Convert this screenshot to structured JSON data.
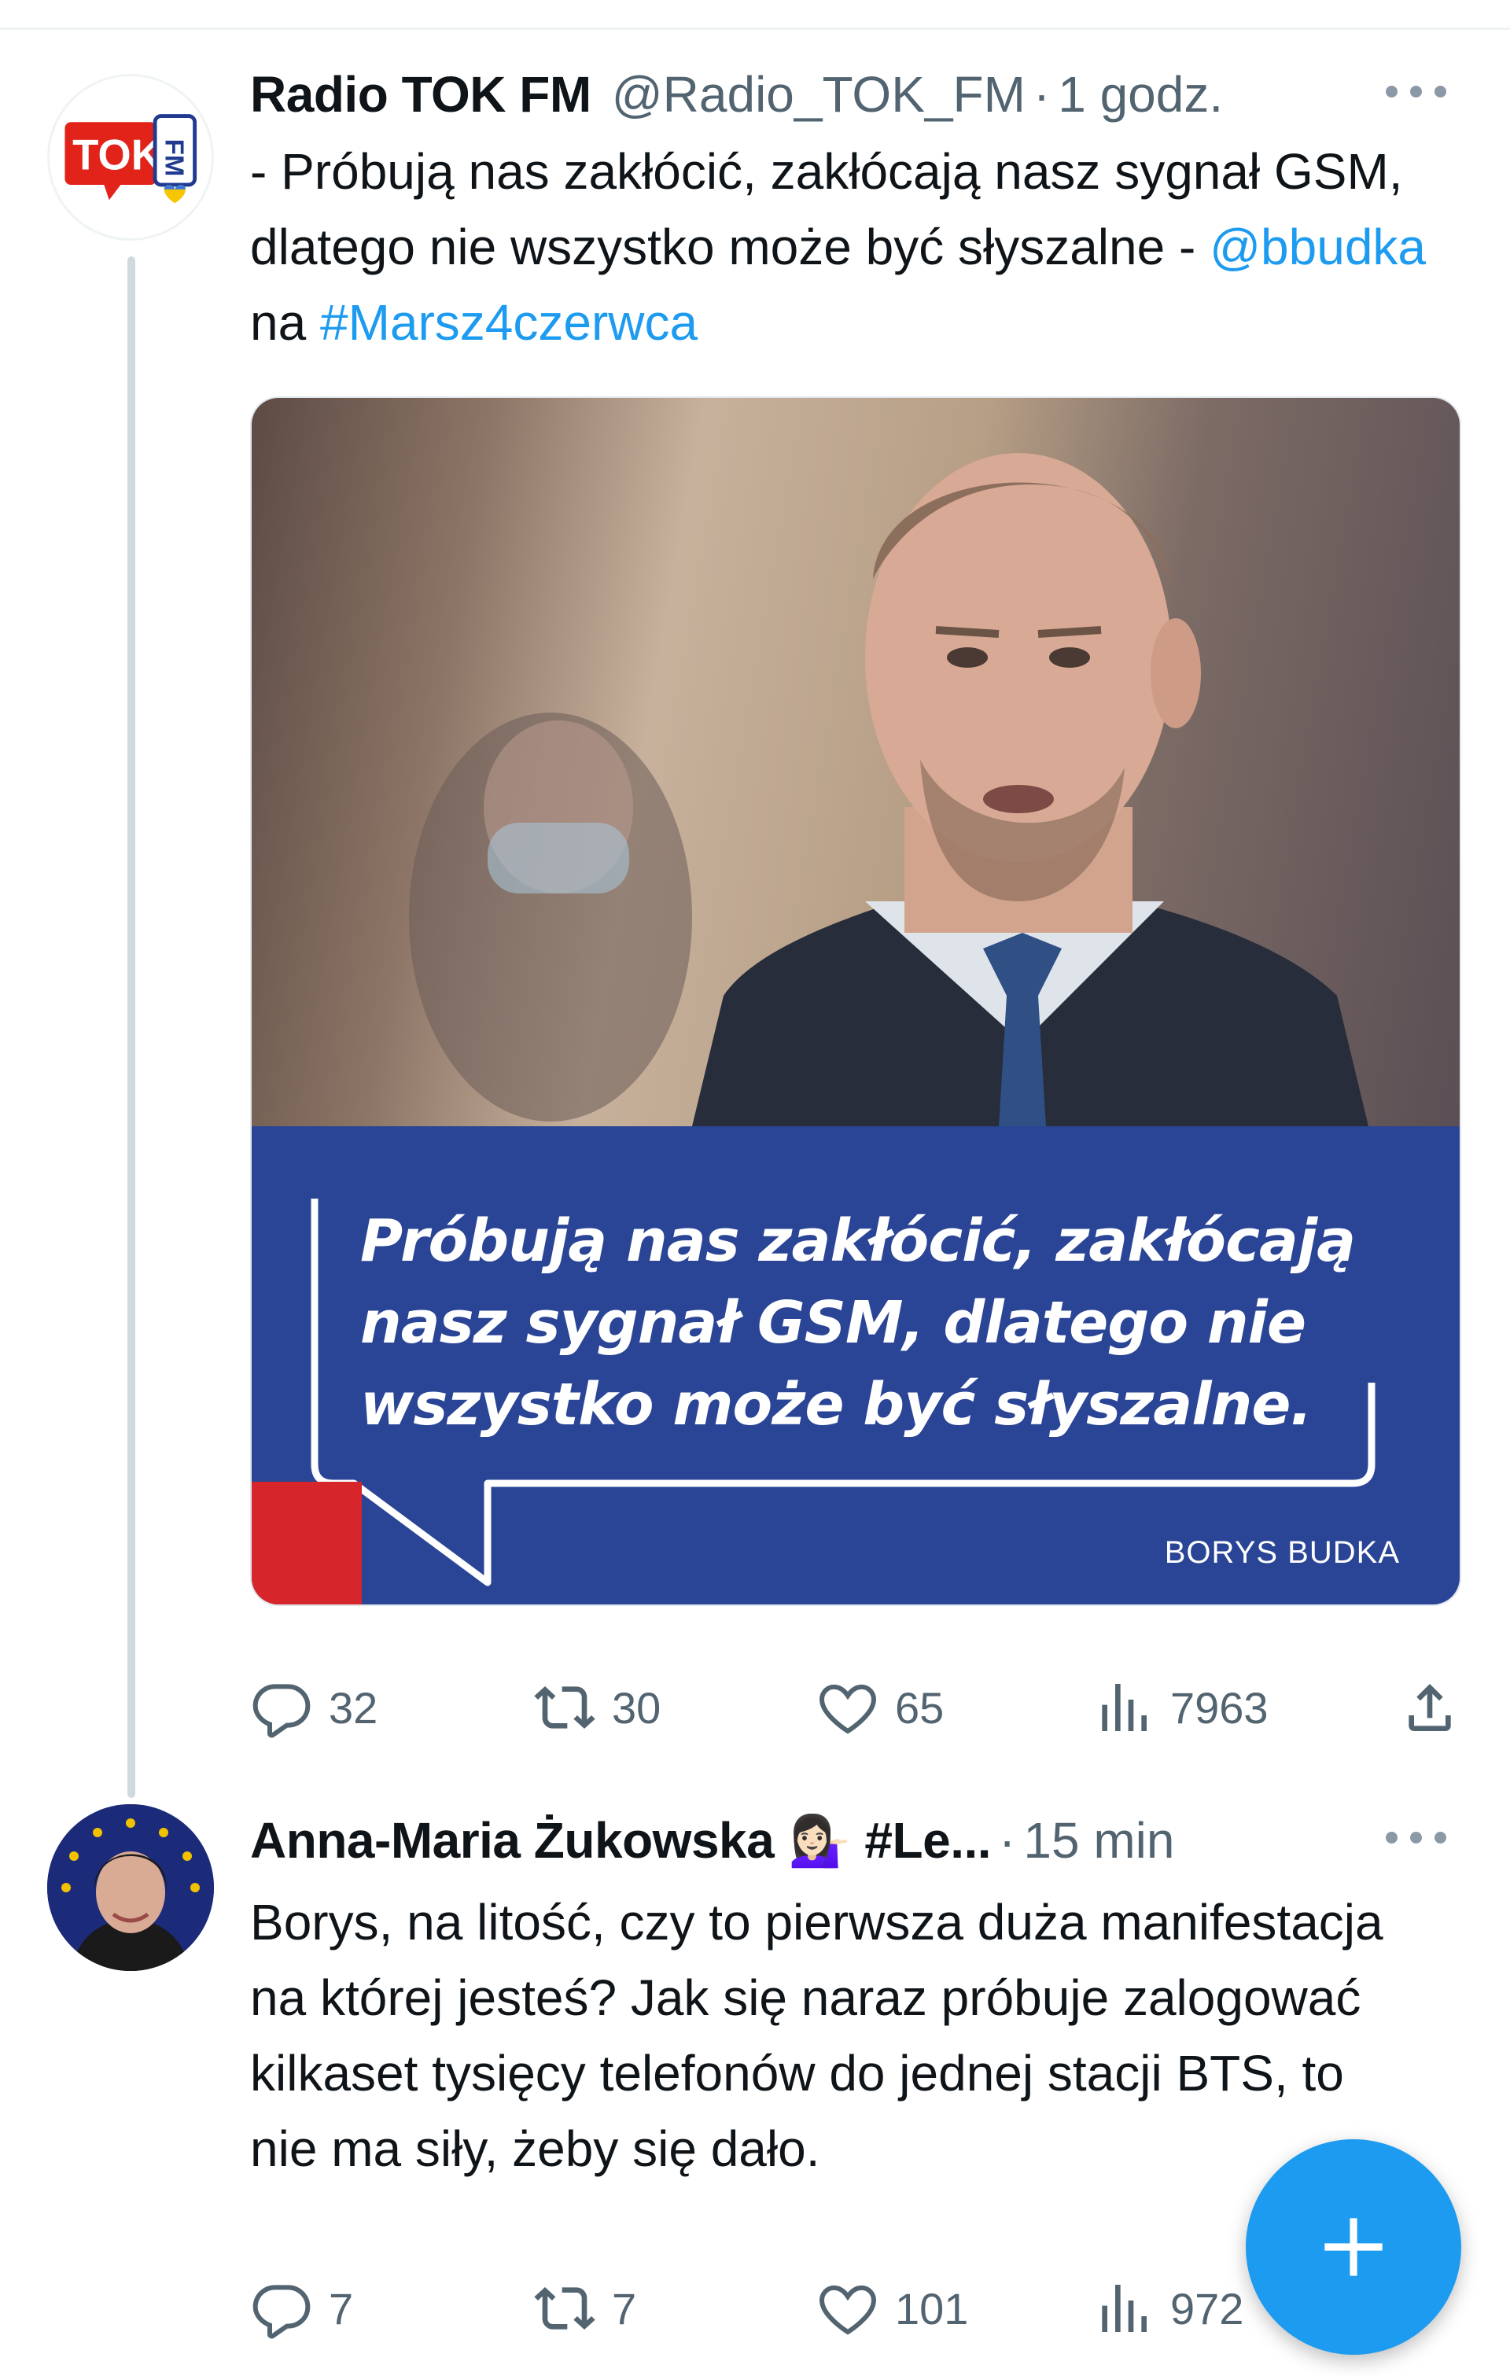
{
  "tweets": [
    {
      "author_name": "Radio TOK FM",
      "handle": "@Radio_TOK_FM",
      "separator": "·",
      "time": "1 godz.",
      "text_before": "- Próbują nas zakłócić, zakłócają nasz sygnał GSM, dlatego nie wszystko może być słyszalne - ",
      "mention": "@bbudka",
      "text_mid": " na ",
      "hashtag": "#Marsz4czerwca",
      "avatar_text": "TOK FM",
      "media": {
        "quote": "Próbują nas zakłócić, zakłócają nasz sygnał GSM, dlatego nie wszystko może być słyszalne.",
        "author": "BORYS BUDKA"
      },
      "stats": {
        "replies": "32",
        "retweets": "30",
        "likes": "65",
        "views": "7963"
      }
    },
    {
      "author_name": "Anna-Maria Żukowska",
      "emoji": "💁🏻‍♀️",
      "name_suffix": "#Le...",
      "separator": "·",
      "time": "15 min",
      "text": "Borys, na litość, czy to pierwsza duża manifestacja na której jesteś? Jak się naraz próbuje zalogować kilkaset tysięcy telefonów do jednej stacji BTS, to nie ma siły, żeby się dało.",
      "stats": {
        "replies": "7",
        "retweets": "7",
        "likes": "101",
        "views": "972"
      }
    }
  ],
  "colors": {
    "link": "#1d9bf0",
    "secondary_text": "#536471",
    "quote_panel": "#2a4496",
    "quote_accent": "#d6262b",
    "tokfm_red": "#e2231a",
    "tokfm_blue": "#1f3a8f"
  },
  "icons": [
    "more-icon",
    "reply-icon",
    "retweet-icon",
    "like-icon",
    "views-icon",
    "share-icon",
    "compose-plus-icon"
  ]
}
